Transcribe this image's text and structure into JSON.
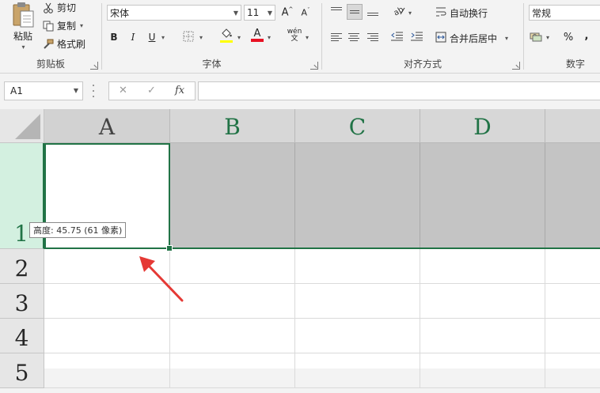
{
  "ribbon": {
    "clipboard": {
      "label": "剪贴板",
      "paste_label": "粘贴",
      "cut_label": "剪切",
      "copy_label": "复制",
      "format_painter_label": "格式刷"
    },
    "font": {
      "label": "字体",
      "font_name": "宋体",
      "font_size": "11",
      "bold": "B",
      "italic": "I",
      "underline": "U",
      "font_color": "#e81123",
      "highlight_color": "#ffff00",
      "phonetic_label": "wén 文"
    },
    "alignment": {
      "label": "对齐方式",
      "wrap_text_label": "自动换行",
      "merge_center_label": "合并后居中"
    },
    "number": {
      "label": "数字",
      "format": "常规",
      "percent": "%",
      "comma": ","
    }
  },
  "formula_bar": {
    "name_box": "A1",
    "fx_label": "fx",
    "formula": ""
  },
  "sheet": {
    "columns": [
      "A",
      "B",
      "C",
      "D"
    ],
    "rows": [
      "1",
      "2",
      "3",
      "4",
      "5"
    ],
    "accent_color": "#217346",
    "height_tooltip": "高度: 45.75 (61 像素)"
  }
}
